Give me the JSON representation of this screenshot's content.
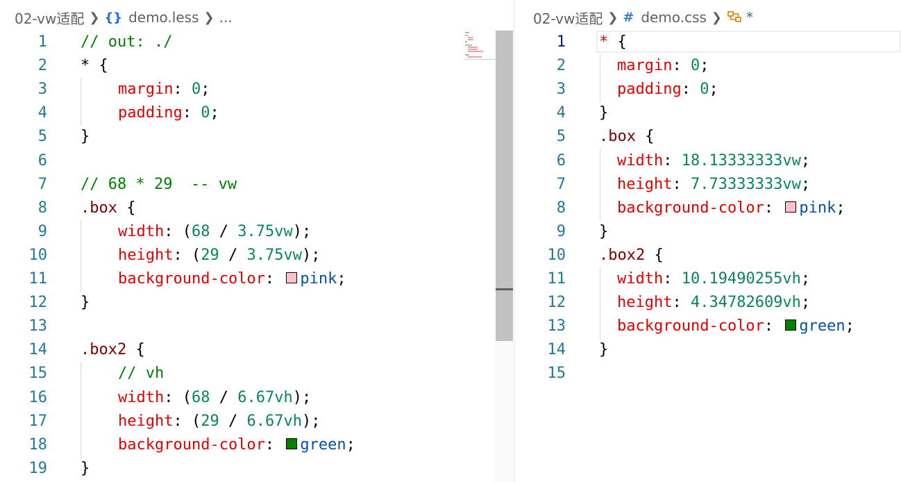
{
  "left_editor": {
    "breadcrumb": {
      "folder": "02-vw适配",
      "file": "demo.less",
      "more": "..."
    },
    "lines": [
      {
        "n": "1",
        "indent": 0,
        "tokens": [
          {
            "c": "c",
            "t": "// out: ./"
          }
        ]
      },
      {
        "n": "2",
        "indent": 0,
        "tokens": [
          {
            "c": "t",
            "t": "* {"
          }
        ]
      },
      {
        "n": "3",
        "indent": 4,
        "tokens": [
          {
            "c": "p",
            "t": "margin"
          },
          {
            "c": "t",
            "t": ": "
          },
          {
            "c": "n",
            "t": "0"
          },
          {
            "c": "t",
            "t": ";"
          }
        ]
      },
      {
        "n": "4",
        "indent": 4,
        "tokens": [
          {
            "c": "p",
            "t": "padding"
          },
          {
            "c": "t",
            "t": ": "
          },
          {
            "c": "n",
            "t": "0"
          },
          {
            "c": "t",
            "t": ";"
          }
        ]
      },
      {
        "n": "5",
        "indent": 0,
        "tokens": [
          {
            "c": "t",
            "t": "}"
          }
        ]
      },
      {
        "n": "6",
        "indent": 0,
        "tokens": []
      },
      {
        "n": "7",
        "indent": 0,
        "tokens": [
          {
            "c": "c",
            "t": "// 68 * 29  -- vw"
          }
        ]
      },
      {
        "n": "8",
        "indent": 0,
        "tokens": [
          {
            "c": "s",
            "t": ".box"
          },
          {
            "c": "t",
            "t": " {"
          }
        ]
      },
      {
        "n": "9",
        "indent": 4,
        "tokens": [
          {
            "c": "p",
            "t": "width"
          },
          {
            "c": "t",
            "t": ": ("
          },
          {
            "c": "n",
            "t": "68"
          },
          {
            "c": "t",
            "t": " / "
          },
          {
            "c": "n",
            "t": "3.75vw"
          },
          {
            "c": "t",
            "t": ");"
          }
        ]
      },
      {
        "n": "10",
        "indent": 4,
        "tokens": [
          {
            "c": "p",
            "t": "height"
          },
          {
            "c": "t",
            "t": ": ("
          },
          {
            "c": "n",
            "t": "29"
          },
          {
            "c": "t",
            "t": " / "
          },
          {
            "c": "n",
            "t": "3.75vw"
          },
          {
            "c": "t",
            "t": ");"
          }
        ]
      },
      {
        "n": "11",
        "indent": 4,
        "tokens": [
          {
            "c": "p",
            "t": "background-color"
          },
          {
            "c": "t",
            "t": ": "
          },
          {
            "swatch": "#ffc0cb"
          },
          {
            "c": "v",
            "t": "pink"
          },
          {
            "c": "t",
            "t": ";"
          }
        ]
      },
      {
        "n": "12",
        "indent": 0,
        "tokens": [
          {
            "c": "t",
            "t": "}"
          }
        ]
      },
      {
        "n": "13",
        "indent": 0,
        "tokens": []
      },
      {
        "n": "14",
        "indent": 0,
        "tokens": [
          {
            "c": "s",
            "t": ".box2"
          },
          {
            "c": "t",
            "t": " {"
          }
        ]
      },
      {
        "n": "15",
        "indent": 4,
        "tokens": [
          {
            "c": "c",
            "t": "// vh"
          }
        ]
      },
      {
        "n": "16",
        "indent": 4,
        "tokens": [
          {
            "c": "p",
            "t": "width"
          },
          {
            "c": "t",
            "t": ": ("
          },
          {
            "c": "n",
            "t": "68"
          },
          {
            "c": "t",
            "t": " / "
          },
          {
            "c": "n",
            "t": "6.67vh"
          },
          {
            "c": "t",
            "t": ");"
          }
        ]
      },
      {
        "n": "17",
        "indent": 4,
        "tokens": [
          {
            "c": "p",
            "t": "height"
          },
          {
            "c": "t",
            "t": ": ("
          },
          {
            "c": "n",
            "t": "29"
          },
          {
            "c": "t",
            "t": " / "
          },
          {
            "c": "n",
            "t": "6.67vh"
          },
          {
            "c": "t",
            "t": ");"
          }
        ]
      },
      {
        "n": "18",
        "indent": 4,
        "tokens": [
          {
            "c": "p",
            "t": "background-color"
          },
          {
            "c": "t",
            "t": ": "
          },
          {
            "swatch": "#008000"
          },
          {
            "c": "v",
            "t": "green"
          },
          {
            "c": "t",
            "t": ";"
          }
        ]
      },
      {
        "n": "19",
        "indent": 0,
        "tokens": [
          {
            "c": "t",
            "t": "}"
          }
        ]
      }
    ]
  },
  "right_editor": {
    "breadcrumb": {
      "folder": "02-vw适配",
      "file": "demo.css",
      "symbol": "*"
    },
    "active_line": "1",
    "lines": [
      {
        "n": "1",
        "indent": 0,
        "tokens": [
          {
            "c": "p",
            "t": "*"
          },
          {
            "c": "t",
            "t": " {"
          }
        ]
      },
      {
        "n": "2",
        "indent": 2,
        "tokens": [
          {
            "c": "p",
            "t": "margin"
          },
          {
            "c": "t",
            "t": ": "
          },
          {
            "c": "n",
            "t": "0"
          },
          {
            "c": "t",
            "t": ";"
          }
        ]
      },
      {
        "n": "3",
        "indent": 2,
        "tokens": [
          {
            "c": "p",
            "t": "padding"
          },
          {
            "c": "t",
            "t": ": "
          },
          {
            "c": "n",
            "t": "0"
          },
          {
            "c": "t",
            "t": ";"
          }
        ]
      },
      {
        "n": "4",
        "indent": 0,
        "tokens": [
          {
            "c": "t",
            "t": "}"
          }
        ]
      },
      {
        "n": "5",
        "indent": 0,
        "tokens": [
          {
            "c": "s",
            "t": ".box"
          },
          {
            "c": "t",
            "t": " {"
          }
        ]
      },
      {
        "n": "6",
        "indent": 2,
        "tokens": [
          {
            "c": "p",
            "t": "width"
          },
          {
            "c": "t",
            "t": ": "
          },
          {
            "c": "n",
            "t": "18.13333333vw"
          },
          {
            "c": "t",
            "t": ";"
          }
        ]
      },
      {
        "n": "7",
        "indent": 2,
        "tokens": [
          {
            "c": "p",
            "t": "height"
          },
          {
            "c": "t",
            "t": ": "
          },
          {
            "c": "n",
            "t": "7.73333333vw"
          },
          {
            "c": "t",
            "t": ";"
          }
        ]
      },
      {
        "n": "8",
        "indent": 2,
        "tokens": [
          {
            "c": "p",
            "t": "background-color"
          },
          {
            "c": "t",
            "t": ": "
          },
          {
            "swatch": "#ffc0cb"
          },
          {
            "c": "v",
            "t": "pink"
          },
          {
            "c": "t",
            "t": ";"
          }
        ]
      },
      {
        "n": "9",
        "indent": 0,
        "tokens": [
          {
            "c": "t",
            "t": "}"
          }
        ]
      },
      {
        "n": "10",
        "indent": 0,
        "tokens": [
          {
            "c": "s",
            "t": ".box2"
          },
          {
            "c": "t",
            "t": " {"
          }
        ]
      },
      {
        "n": "11",
        "indent": 2,
        "tokens": [
          {
            "c": "p",
            "t": "width"
          },
          {
            "c": "t",
            "t": ": "
          },
          {
            "c": "n",
            "t": "10.19490255vh"
          },
          {
            "c": "t",
            "t": ";"
          }
        ]
      },
      {
        "n": "12",
        "indent": 2,
        "tokens": [
          {
            "c": "p",
            "t": "height"
          },
          {
            "c": "t",
            "t": ": "
          },
          {
            "c": "n",
            "t": "4.34782609vh"
          },
          {
            "c": "t",
            "t": ";"
          }
        ]
      },
      {
        "n": "13",
        "indent": 2,
        "tokens": [
          {
            "c": "p",
            "t": "background-color"
          },
          {
            "c": "t",
            "t": ": "
          },
          {
            "swatch": "#008000"
          },
          {
            "c": "v",
            "t": "green"
          },
          {
            "c": "t",
            "t": ";"
          }
        ]
      },
      {
        "n": "14",
        "indent": 0,
        "tokens": [
          {
            "c": "t",
            "t": "}"
          }
        ]
      },
      {
        "n": "15",
        "indent": 0,
        "tokens": []
      }
    ]
  },
  "icons": {
    "left_file": "less-braces-icon",
    "right_file": "css-hash-icon",
    "right_symbol": "symbol-class-icon"
  },
  "colors": {
    "comment": "#008000",
    "property": "#e50000",
    "number": "#098658",
    "selector": "#800000",
    "value_keyword": "#0451a5",
    "line_number": "#237893",
    "active_line_number": "#0b216f"
  }
}
